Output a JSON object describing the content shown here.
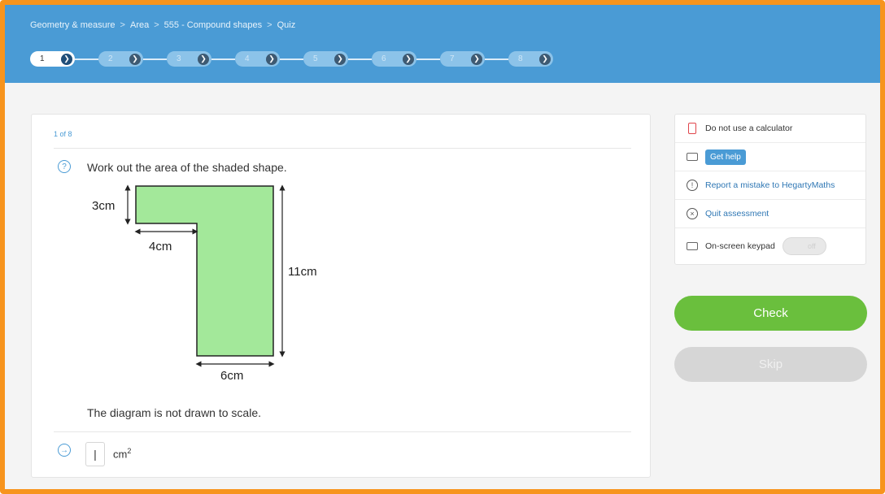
{
  "header": {
    "breadcrumb": [
      "Geometry & measure",
      "Area",
      "555 - Compound shapes",
      "Quiz"
    ],
    "breadcrumb_separator": ">",
    "steps": [
      {
        "label": "1",
        "state": "current"
      },
      {
        "label": "2",
        "state": "upcoming"
      },
      {
        "label": "3",
        "state": "upcoming"
      },
      {
        "label": "4",
        "state": "upcoming"
      },
      {
        "label": "5",
        "state": "upcoming"
      },
      {
        "label": "6",
        "state": "upcoming"
      },
      {
        "label": "7",
        "state": "upcoming"
      },
      {
        "label": "8",
        "state": "upcoming"
      }
    ],
    "step_go_glyph": "❯"
  },
  "question": {
    "counter": "1 of 8",
    "icon": "question-circle-icon",
    "text": "Work out the area of the shaded shape.",
    "diagram": {
      "label_top_height": "3cm",
      "label_notch_width": "4cm",
      "label_total_height": "11cm",
      "label_bottom_width": "6cm",
      "fill_color": "#a3e89a"
    },
    "note": "The diagram is not drawn to scale.",
    "answer": {
      "icon": "arrow-circle-icon",
      "value": "|",
      "unit": "cm",
      "unit_power": "2"
    }
  },
  "sidebar": {
    "items": [
      {
        "icon": "calculator-icon",
        "label": "Do not use a calculator"
      },
      {
        "icon": "video-icon",
        "label": "Get help"
      },
      {
        "icon": "exclamation-circle-icon",
        "label": "Report a mistake to HegartyMaths"
      },
      {
        "icon": "close-circle-icon",
        "label": "Quit assessment"
      },
      {
        "icon": "keyboard-icon",
        "label": "On-screen keypad",
        "toggle_state": "off"
      }
    ]
  },
  "buttons": {
    "check": "Check",
    "skip": "Skip"
  },
  "colors": {
    "accent": "#4a9bd5",
    "frame": "#f7941d",
    "check": "#6abf3d",
    "skip": "#d6d6d6"
  }
}
